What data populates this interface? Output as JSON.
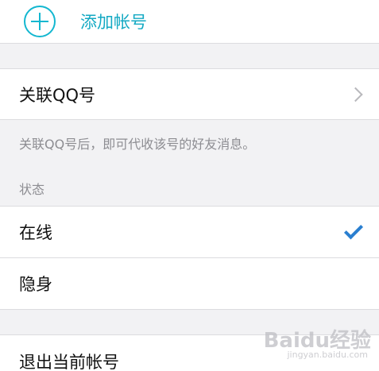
{
  "add_account": {
    "label": "添加帐号",
    "icon": "plus-circle-icon"
  },
  "link_qq": {
    "label": "关联QQ号",
    "icon": "chevron-right-icon",
    "hint": "关联QQ号后，即可代收该号的好友消息。"
  },
  "status": {
    "section_title": "状态",
    "options": [
      {
        "label": "在线",
        "selected": true
      },
      {
        "label": "隐身",
        "selected": false
      }
    ]
  },
  "logout": {
    "label": "退出当前帐号"
  },
  "watermark": {
    "text": "Baidu经验",
    "sub": "jingyan.baidu.com"
  },
  "colors": {
    "accent": "#13b7d0",
    "check": "#2a7fd0"
  }
}
